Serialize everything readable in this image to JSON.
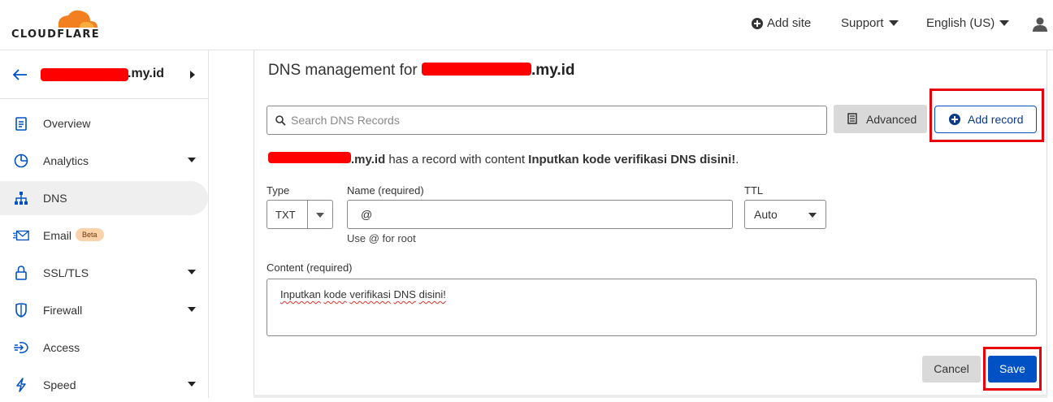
{
  "brand": {
    "name": "CLOUDFLARE",
    "orange": "#f38020",
    "accent_blue": "#0051c3"
  },
  "header": {
    "add_site_label": "Add site",
    "support_label": "Support",
    "language_label": "English (US)",
    "user_icon": "user-icon"
  },
  "sidebar": {
    "zone_suffix": ".my.id",
    "items": [
      {
        "label": "Overview",
        "icon": "clipboard-icon",
        "has_caret": false
      },
      {
        "label": "Analytics",
        "icon": "pie-chart-icon",
        "has_caret": true
      },
      {
        "label": "DNS",
        "icon": "network-icon",
        "has_caret": false,
        "active": true
      },
      {
        "label": "Email",
        "icon": "envelope-icon",
        "has_caret": false,
        "badge": "Beta"
      },
      {
        "label": "SSL/TLS",
        "icon": "lock-icon",
        "has_caret": true
      },
      {
        "label": "Firewall",
        "icon": "shield-icon",
        "has_caret": true
      },
      {
        "label": "Access",
        "icon": "sign-in-icon",
        "has_caret": false
      },
      {
        "label": "Speed",
        "icon": "lightning-icon",
        "has_caret": true
      }
    ]
  },
  "main": {
    "title_prefix": "DNS management for",
    "title_domain_suffix": ".my.id",
    "search_placeholder": "Search DNS Records",
    "advanced_label": "Advanced",
    "add_record_label": "Add record",
    "message": {
      "domain_suffix": ".my.id",
      "middle": " has a record with content ",
      "content": "Inputkan kode verifikasi DNS disini!",
      "end": "."
    },
    "form": {
      "type_label": "Type",
      "type_value": "TXT",
      "name_label": "Name (required)",
      "name_value": "@",
      "name_hint": "Use @ for root",
      "ttl_label": "TTL",
      "ttl_value": "Auto",
      "content_label": "Content (required)",
      "content_words": [
        "Inputkan",
        "kode",
        "verifikasi",
        "DNS",
        "disini!"
      ]
    },
    "cancel_label": "Cancel",
    "save_label": "Save"
  },
  "annotation_color": "#e8000b"
}
